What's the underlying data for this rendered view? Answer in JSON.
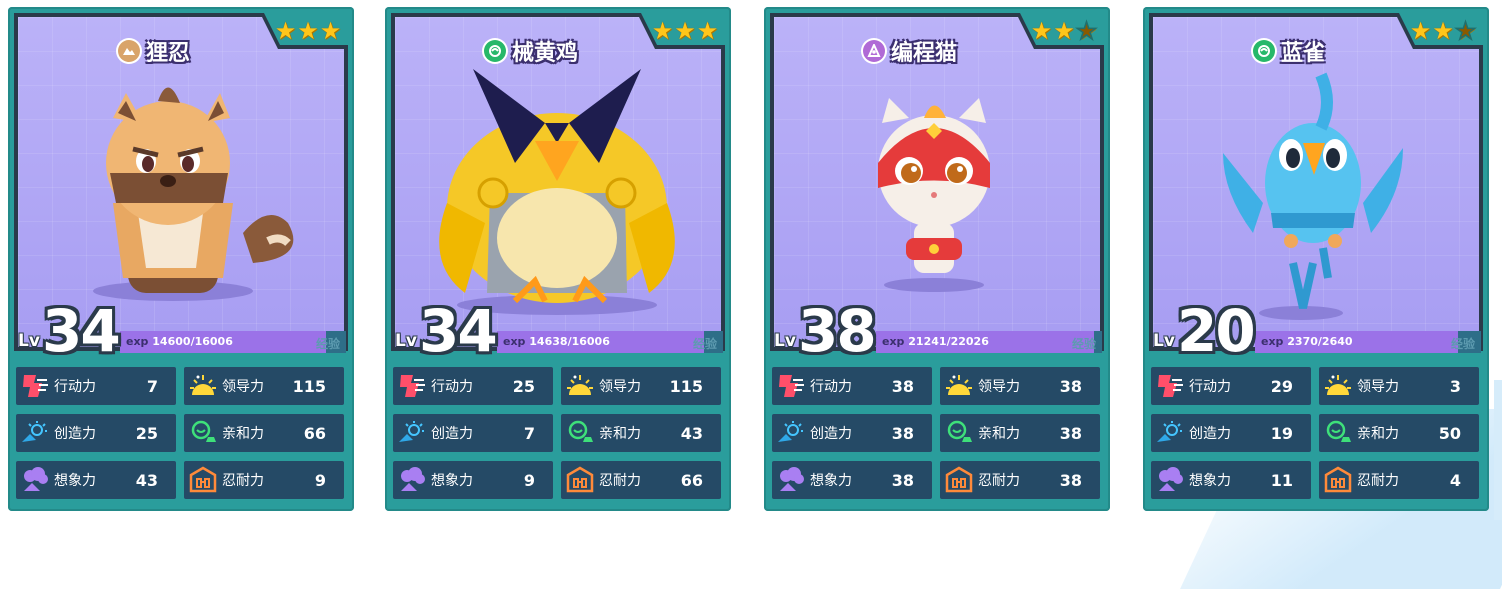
{
  "cards": [
    {
      "name": "狸忍",
      "element_icon": "earth-icon",
      "element_color": "#d9a46a",
      "stars": 3,
      "level": "34",
      "level_prefix": "Lv",
      "exp_prefix": "exp",
      "exp_current": "14600",
      "exp_max": "/16006",
      "exp_fraction": 0.912,
      "exp_label": "经验",
      "stats": [
        {
          "label": "行动力",
          "value": "7",
          "icon": "action-icon"
        },
        {
          "label": "领导力",
          "value": "115",
          "icon": "leadership-icon"
        },
        {
          "label": "创造力",
          "value": "25",
          "icon": "creativity-icon"
        },
        {
          "label": "亲和力",
          "value": "66",
          "icon": "affinity-icon"
        },
        {
          "label": "想象力",
          "value": "43",
          "icon": "imagination-icon"
        },
        {
          "label": "忍耐力",
          "value": "9",
          "icon": "endurance-icon"
        }
      ]
    },
    {
      "name": "械黄鸡",
      "element_icon": "wind-icon",
      "element_color": "#27b86a",
      "stars": 3,
      "level": "34",
      "level_prefix": "Lv",
      "exp_prefix": "exp",
      "exp_current": "14638",
      "exp_max": "/16006",
      "exp_fraction": 0.915,
      "exp_label": "经验",
      "stats": [
        {
          "label": "行动力",
          "value": "25",
          "icon": "action-icon"
        },
        {
          "label": "领导力",
          "value": "115",
          "icon": "leadership-icon"
        },
        {
          "label": "创造力",
          "value": "7",
          "icon": "creativity-icon"
        },
        {
          "label": "亲和力",
          "value": "43",
          "icon": "affinity-icon"
        },
        {
          "label": "想象力",
          "value": "9",
          "icon": "imagination-icon"
        },
        {
          "label": "忍耐力",
          "value": "66",
          "icon": "endurance-icon"
        }
      ]
    },
    {
      "name": "编程猫",
      "element_icon": "magic-icon",
      "element_color": "#b06ad6",
      "stars": 2,
      "level": "38",
      "level_prefix": "Lv",
      "exp_prefix": "exp",
      "exp_current": "21241",
      "exp_max": "/22026",
      "exp_fraction": 0.964,
      "exp_label": "经验",
      "stats": [
        {
          "label": "行动力",
          "value": "38",
          "icon": "action-icon"
        },
        {
          "label": "领导力",
          "value": "38",
          "icon": "leadership-icon"
        },
        {
          "label": "创造力",
          "value": "38",
          "icon": "creativity-icon"
        },
        {
          "label": "亲和力",
          "value": "38",
          "icon": "affinity-icon"
        },
        {
          "label": "想象力",
          "value": "38",
          "icon": "imagination-icon"
        },
        {
          "label": "忍耐力",
          "value": "38",
          "icon": "endurance-icon"
        }
      ]
    },
    {
      "name": "蓝雀",
      "element_icon": "wind-icon",
      "element_color": "#27b86a",
      "stars": 2,
      "level": "20",
      "level_prefix": "Lv",
      "exp_prefix": "exp",
      "exp_current": "2370",
      "exp_max": "/2640",
      "exp_fraction": 0.898,
      "exp_label": "经验",
      "stats": [
        {
          "label": "行动力",
          "value": "29",
          "icon": "action-icon"
        },
        {
          "label": "领导力",
          "value": "3",
          "icon": "leadership-icon"
        },
        {
          "label": "创造力",
          "value": "19",
          "icon": "creativity-icon"
        },
        {
          "label": "亲和力",
          "value": "50",
          "icon": "affinity-icon"
        },
        {
          "label": "想象力",
          "value": "11",
          "icon": "imagination-icon"
        },
        {
          "label": "忍耐力",
          "value": "4",
          "icon": "endurance-icon"
        }
      ]
    }
  ]
}
